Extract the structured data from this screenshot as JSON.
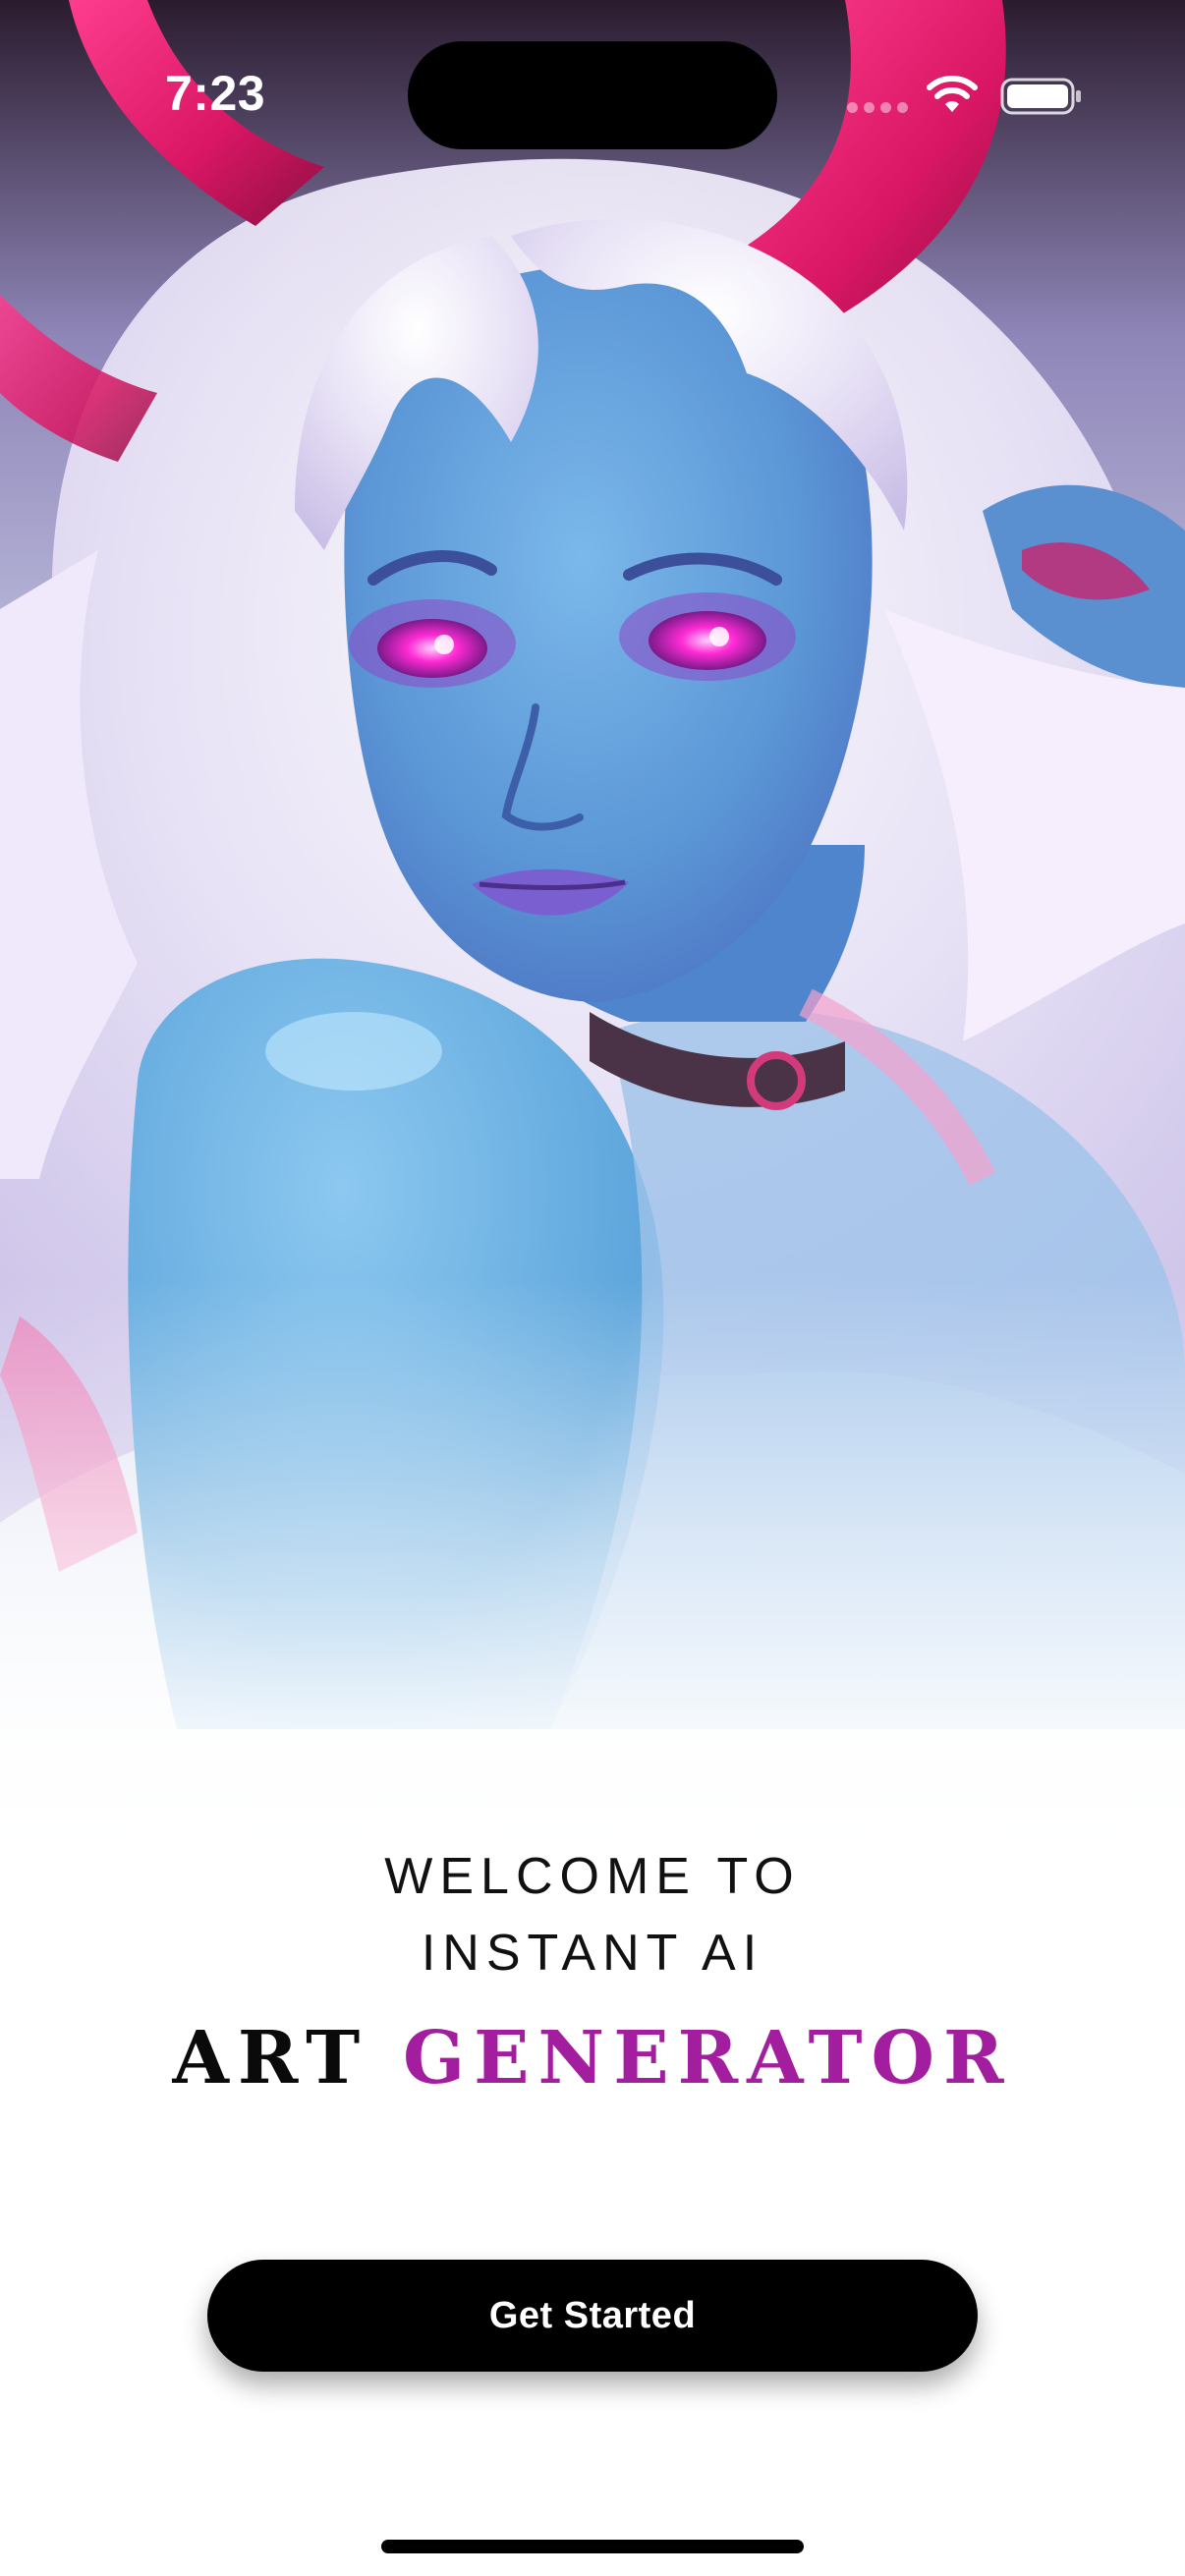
{
  "status_bar": {
    "time": "7:23",
    "wifi_icon": "wifi-icon",
    "battery_icon": "battery-icon",
    "signal_icon": "cellular-signal-dots-icon"
  },
  "hero": {
    "image_subject": "ai-generated-artwork",
    "accent_colors": [
      "#e6206f",
      "#5fa8d8",
      "#f3e6ef"
    ]
  },
  "welcome": {
    "line_1": "WELCOME TO",
    "line_2": "INSTANT AI"
  },
  "headline": {
    "word_1": "ART",
    "word_2": "GENERATOR",
    "word_1_color": "#0a0a0a",
    "word_2_color": "#a21e9e"
  },
  "cta": {
    "label": "Get Started"
  }
}
